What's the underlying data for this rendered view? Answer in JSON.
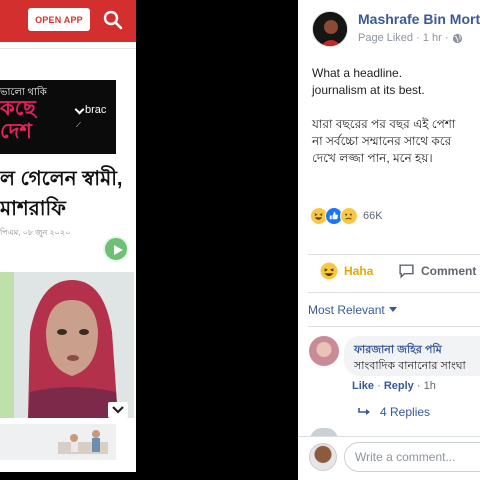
{
  "news_site": {
    "open_app_label": "OPEN APP",
    "ad": {
      "small_text": "ভালো থাকি",
      "big_line1": "কছে",
      "big_line2": "দেশ",
      "brand": "brac"
    },
    "headline_line1": "ল গেলেন স্বামী,",
    "headline_line2": "মাশরাফি",
    "date": "পিএম, ০৮ জুন ২০২০"
  },
  "post": {
    "author": "Mashrafe Bin Mortaza",
    "meta": "Page Liked · 1 hr ·",
    "text_lines": [
      "What a headline.",
      "journalism at its best."
    ],
    "bangla_lines": [
      "যারা বছরের পর বছর এই পেশা",
      "না সর্বচ্চো সম্মানের সাথে করে",
      "দেখে লজ্জা পান, মনে হয়।"
    ],
    "reaction_count": "66K",
    "actions": {
      "haha": "Haha",
      "comment": "Comment"
    },
    "sort_label": "Most Relevant"
  },
  "comment": {
    "name": "ফারজানা জহির পমি",
    "text": "সাংবাদিক বানানোর সাংঘা",
    "like": "Like",
    "reply": "Reply",
    "time": "1h",
    "replies_label": "4 Replies"
  },
  "composer": {
    "placeholder": "Write a comment..."
  },
  "colors": {
    "news_red": "#d32f2f",
    "fb_blue": "#385898",
    "haha_yellow": "#e6a800"
  }
}
